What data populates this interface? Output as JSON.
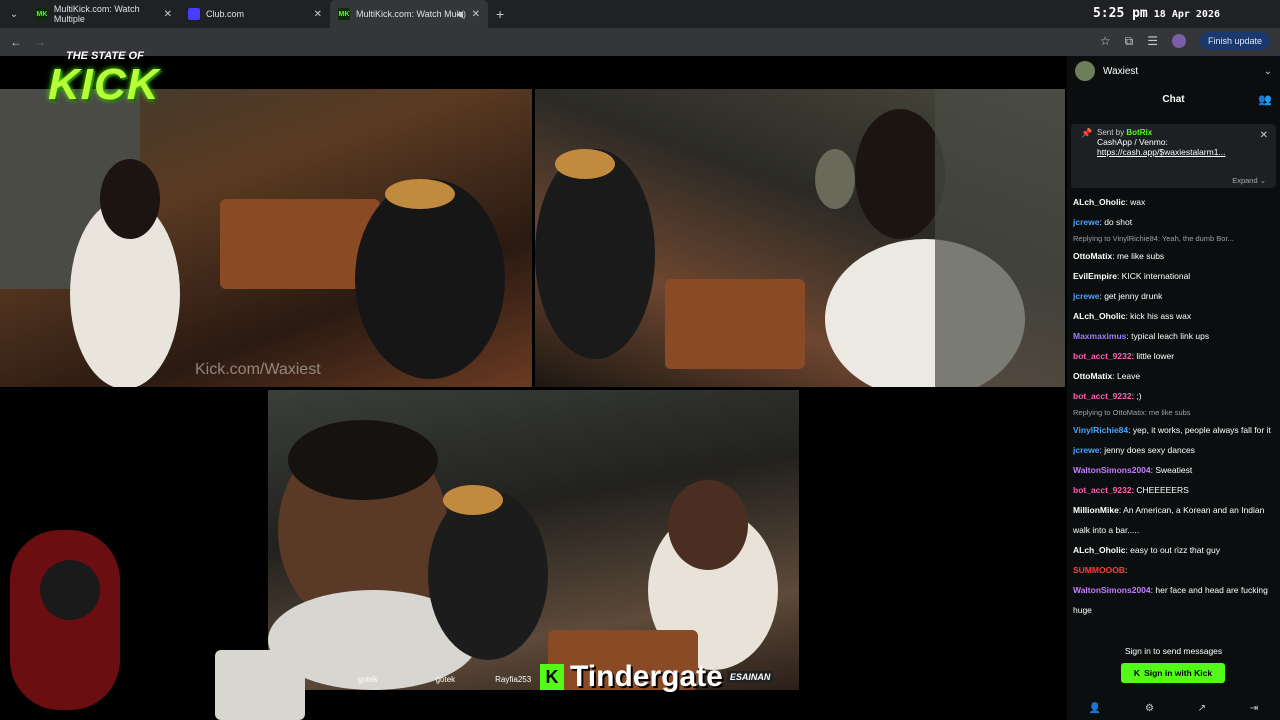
{
  "tabs": [
    {
      "title": "MultiKick.com: Watch Multiple",
      "fav": "MK",
      "fav_color": "#53fc18"
    },
    {
      "title": "Club.com",
      "fav": "",
      "fav_color": "#4b3bff"
    },
    {
      "title": "MultiKick.com: Watch Mult",
      "fav": "MK",
      "fav_color": "#53fc18"
    }
  ],
  "clock": {
    "time": "5:25 pm",
    "date": "18 Apr 2026"
  },
  "finish_update": "Finish update",
  "logo": {
    "line1": "THE STATE OF",
    "line2": "KICK"
  },
  "watermark": "Kick.com/Waxiest",
  "bottom_names": [
    "gotek",
    "gotek",
    "Rayfia253"
  ],
  "ticker": {
    "text": "Tindergate",
    "tag": "ESAINAN"
  },
  "chat": {
    "channel": "Waxiest",
    "title": "Chat",
    "pinned": {
      "sent_by": "Sent by",
      "sender": "BotRix",
      "line1": "CashApp / Venmo:",
      "link": "https://cash.app/$waxiestalarm1...",
      "expand": "Expand"
    },
    "messages": [
      {
        "user": "ALch_Oholic",
        "color": "#ffffff",
        "text": "wax"
      },
      {
        "user": "jcrewe",
        "color": "#4da3ff",
        "text": "do shot"
      },
      {
        "reply": "Replying to VinylRichie84: Yeah, the dumb Bor..."
      },
      {
        "user": "OttoMatix",
        "color": "#ffffff",
        "text": "me like subs"
      },
      {
        "user": "EvilEmpire",
        "color": "#ffffff",
        "text": "KICK international"
      },
      {
        "user": "jcrewe",
        "color": "#4da3ff",
        "text": "get jenny drunk"
      },
      {
        "user": "ALch_Oholic",
        "color": "#ffffff",
        "text": "kick his ass wax"
      },
      {
        "user": "Maxmaximus",
        "color": "#9b7bff",
        "text": "typical leach link ups"
      },
      {
        "user": "bot_acct_9232",
        "color": "#ff5fb0",
        "text": "little lower"
      },
      {
        "user": "OttoMatix",
        "color": "#ffffff",
        "text": "Leave"
      },
      {
        "user": "bot_acct_9232",
        "color": "#ff5fb0",
        "text": ";)"
      },
      {
        "reply": "Replying to OttoMatix: me like subs"
      },
      {
        "user": "VinylRichie84",
        "color": "#4da3ff",
        "text": "yep, it works, people always fall for it"
      },
      {
        "user": "jcrewe",
        "color": "#4da3ff",
        "text": "jenny does sexy dances"
      },
      {
        "user": "WaltonSimons2004",
        "color": "#c77dff",
        "text": "Sweatiest"
      },
      {
        "user": "bot_acct_9232",
        "color": "#ff5fb0",
        "text": "CHEEEEERS"
      },
      {
        "user": "MillionMike",
        "color": "#ffffff",
        "text": "An American, a Korean and an Indian walk into a bar....."
      },
      {
        "user": "ALch_Oholic",
        "color": "#ffffff",
        "text": "easy to out rizz that guy"
      },
      {
        "user": "SUMMOOOB",
        "color": "#ff3b3b",
        "text": ""
      },
      {
        "user": "WaltonSimons2004",
        "color": "#c77dff",
        "text": "her face and head are fucking huge"
      }
    ],
    "signin_text": "Sign in to send messages",
    "signin_button": "Sign in with Kick"
  }
}
